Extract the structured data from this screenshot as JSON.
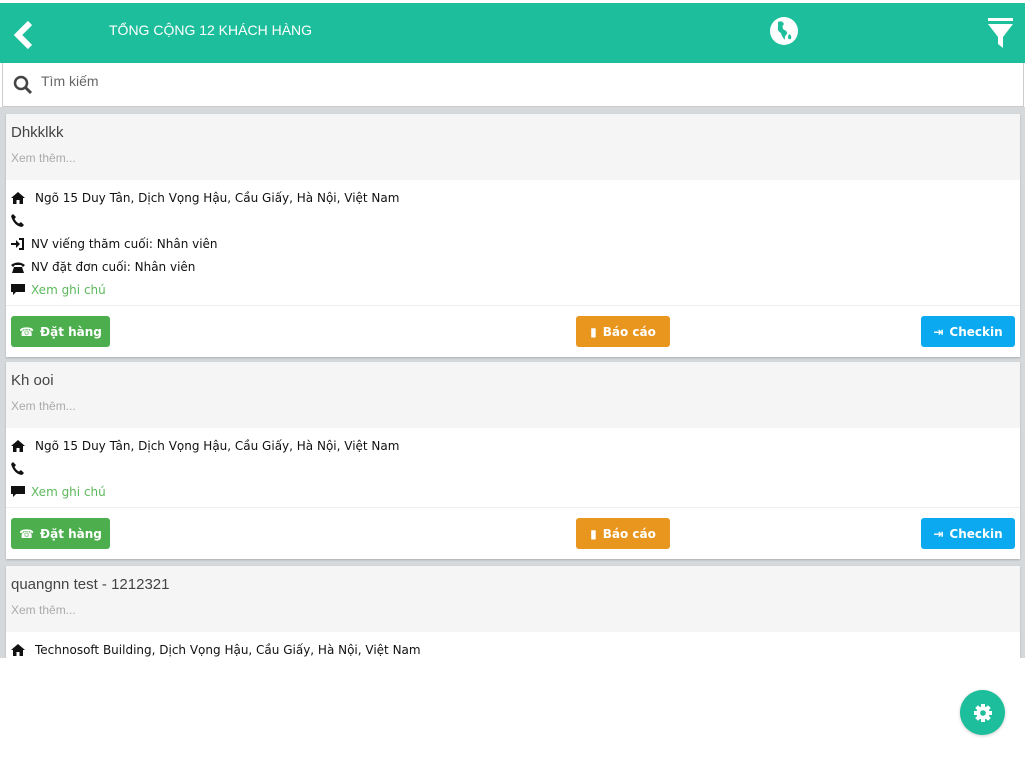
{
  "header": {
    "title": "TỔNG CỘNG 12 KHÁCH HÀNG",
    "back_icon": "chevron-left-icon",
    "map_icon": "globe-icon",
    "filter_icon": "filter-icon"
  },
  "search": {
    "placeholder": "Tìm kiếm",
    "value": ""
  },
  "labels": {
    "more": "Xem thêm...",
    "note": "Xem ghi chú",
    "order": "Đặt hàng",
    "report": "Báo cáo",
    "checkin": "Checkin"
  },
  "customers": [
    {
      "name": "Dhkklkk",
      "address": "Ngõ 15 Duy Tân, Dịch Vọng Hậu, Cầu Giấy, Hà Nội, Việt Nam",
      "phone": "",
      "last_visit": "NV viếng thăm cuối: Nhân viên",
      "last_order": "NV đặt đơn cuối: Nhân viên"
    },
    {
      "name": "Kh ooi",
      "address": "Ngõ 15 Duy Tân, Dịch Vọng Hậu, Cầu Giấy, Hà Nội, Việt Nam",
      "phone": ""
    },
    {
      "name": "quangnn test - 1212321",
      "address": "Technosoft Building, Dịch Vọng Hậu, Cầu Giấy, Hà Nội, Việt Nam"
    }
  ],
  "colors": {
    "primary": "#1dbe9b",
    "order": "#4cae4c",
    "report": "#e8961e",
    "checkin": "#0aa9f0",
    "note": "#5cb85c"
  }
}
